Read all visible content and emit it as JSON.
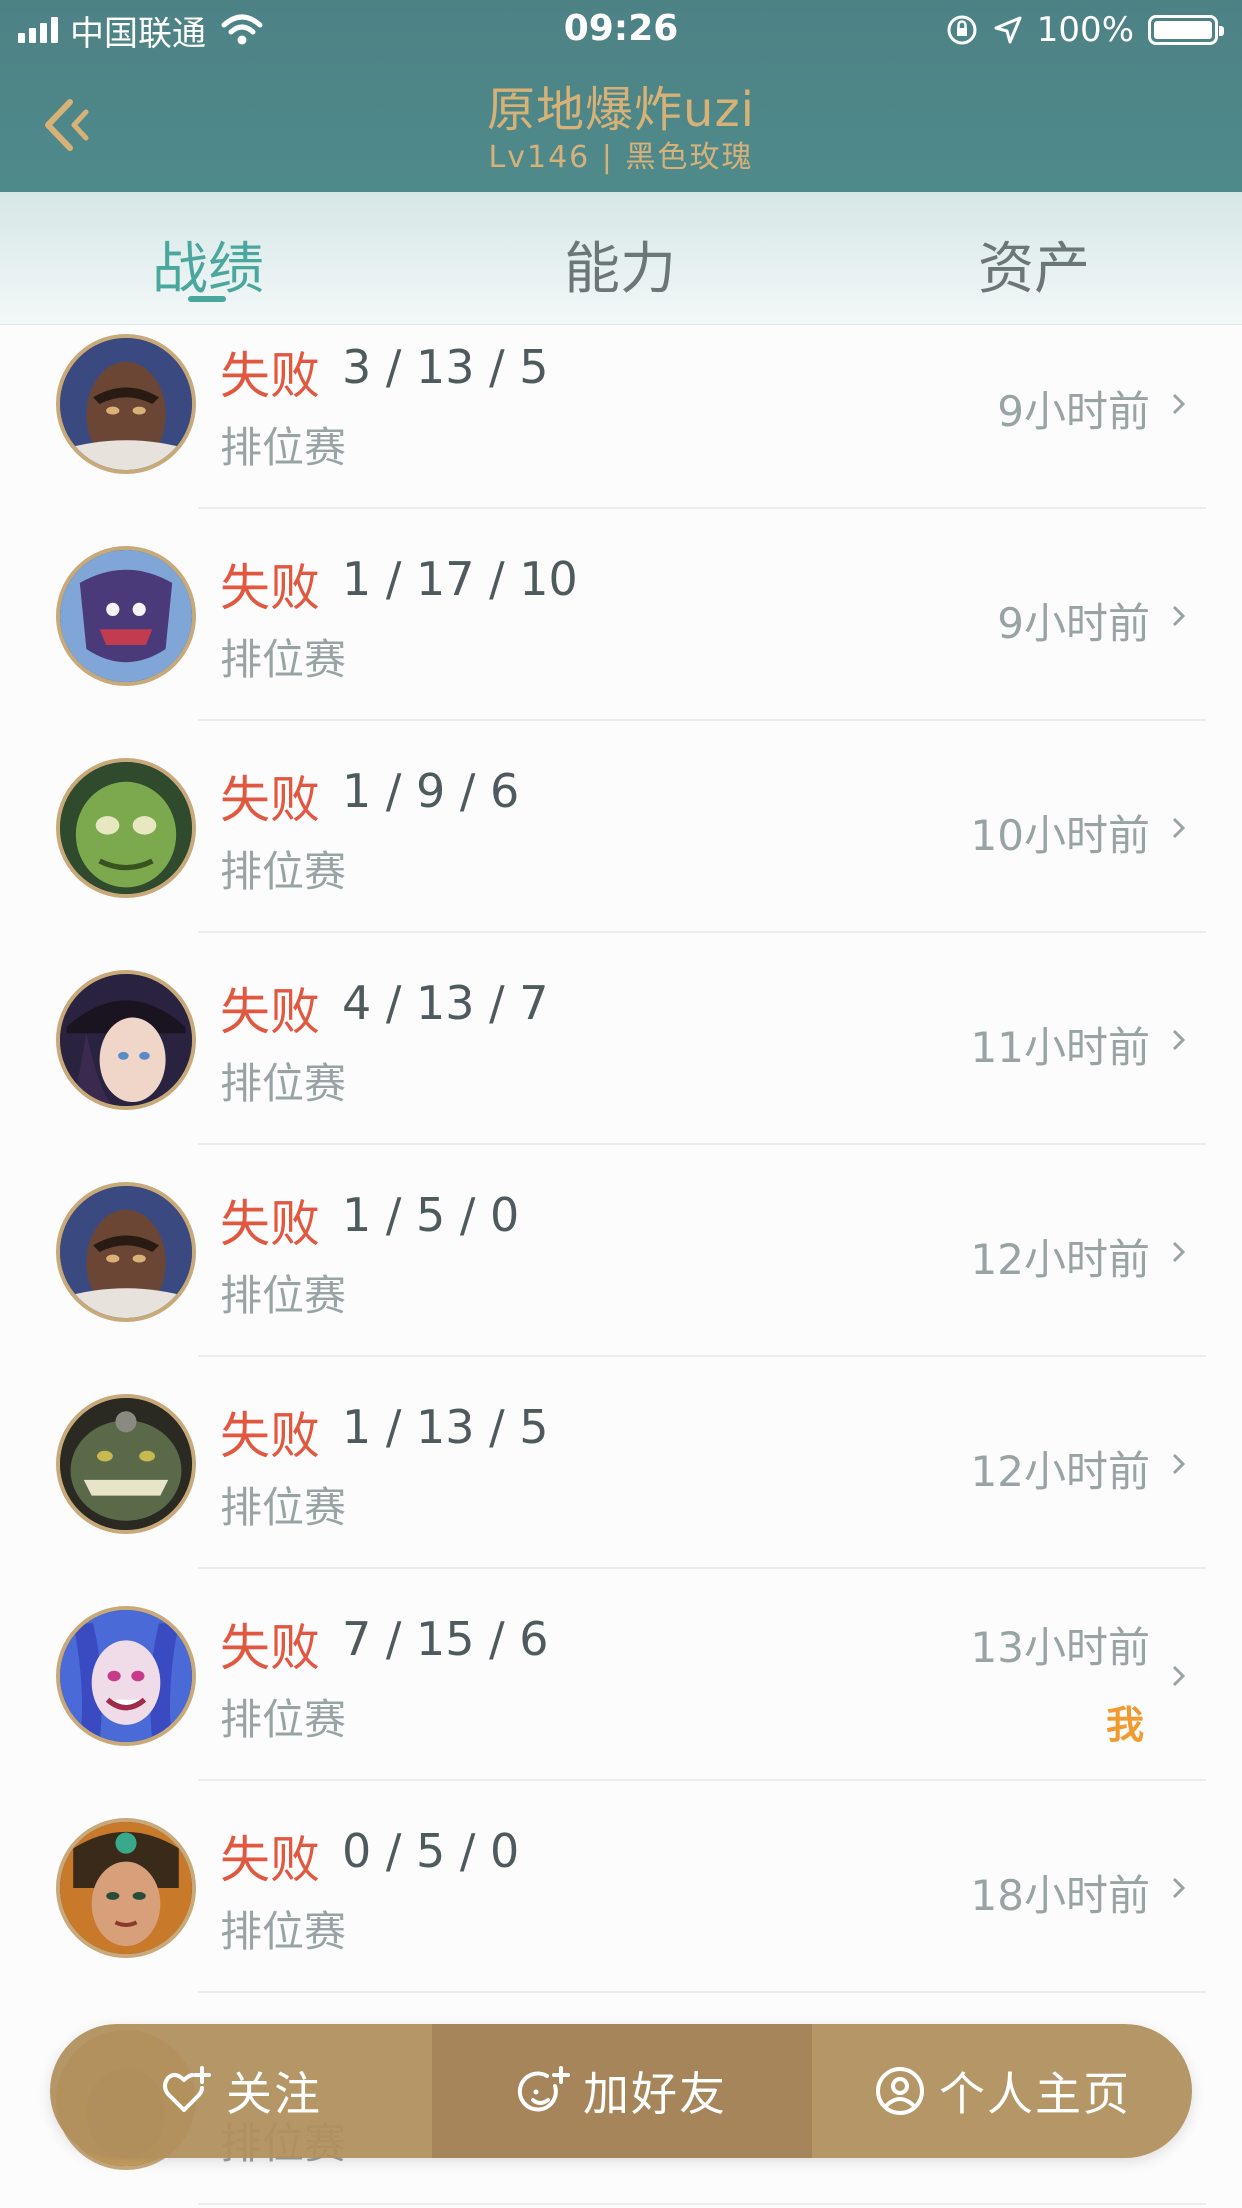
{
  "status_bar": {
    "carrier": "中国联通",
    "time": "09:26",
    "battery": "100%",
    "icons": [
      "signal-icon",
      "wifi-icon",
      "orientation-lock-icon",
      "location-icon",
      "battery-icon"
    ]
  },
  "header": {
    "title": "原地爆炸uzi",
    "subtitle": "Lv146 | 黑色玫瑰",
    "back_icon": "chevron-left-icon"
  },
  "tabs": [
    {
      "label": "战绩",
      "active": true
    },
    {
      "label": "能力",
      "active": false
    },
    {
      "label": "资产",
      "active": false
    }
  ],
  "matches": [
    {
      "result": "失败",
      "kda": "3 / 13 / 5",
      "mode": "排位赛",
      "time": "9小时前",
      "me": ""
    },
    {
      "result": "失败",
      "kda": "1 / 17 / 10",
      "mode": "排位赛",
      "time": "9小时前",
      "me": ""
    },
    {
      "result": "失败",
      "kda": "1 / 9 / 6",
      "mode": "排位赛",
      "time": "10小时前",
      "me": ""
    },
    {
      "result": "失败",
      "kda": "4 / 13 / 7",
      "mode": "排位赛",
      "time": "11小时前",
      "me": ""
    },
    {
      "result": "失败",
      "kda": "1 / 5 / 0",
      "mode": "排位赛",
      "time": "12小时前",
      "me": ""
    },
    {
      "result": "失败",
      "kda": "1 / 13 / 5",
      "mode": "排位赛",
      "time": "12小时前",
      "me": ""
    },
    {
      "result": "失败",
      "kda": "7 / 15 / 6",
      "mode": "排位赛",
      "time": "13小时前",
      "me": "我"
    },
    {
      "result": "失败",
      "kda": "0 / 5 / 0",
      "mode": "排位赛",
      "time": "18小时前",
      "me": ""
    },
    {
      "result": "",
      "kda": "",
      "mode": "排位赛",
      "time": "",
      "me": ""
    }
  ],
  "actions": {
    "follow": "关注",
    "add_friend": "加好友",
    "profile": "个人主页"
  },
  "colors": {
    "header_bg": "#4f8a8b",
    "title_gold": "#d7b277",
    "active_tab": "#4aa79d",
    "loss_red": "#e2573f",
    "me_badge": "#f19a2e",
    "action_bar": "#b08f5c"
  }
}
